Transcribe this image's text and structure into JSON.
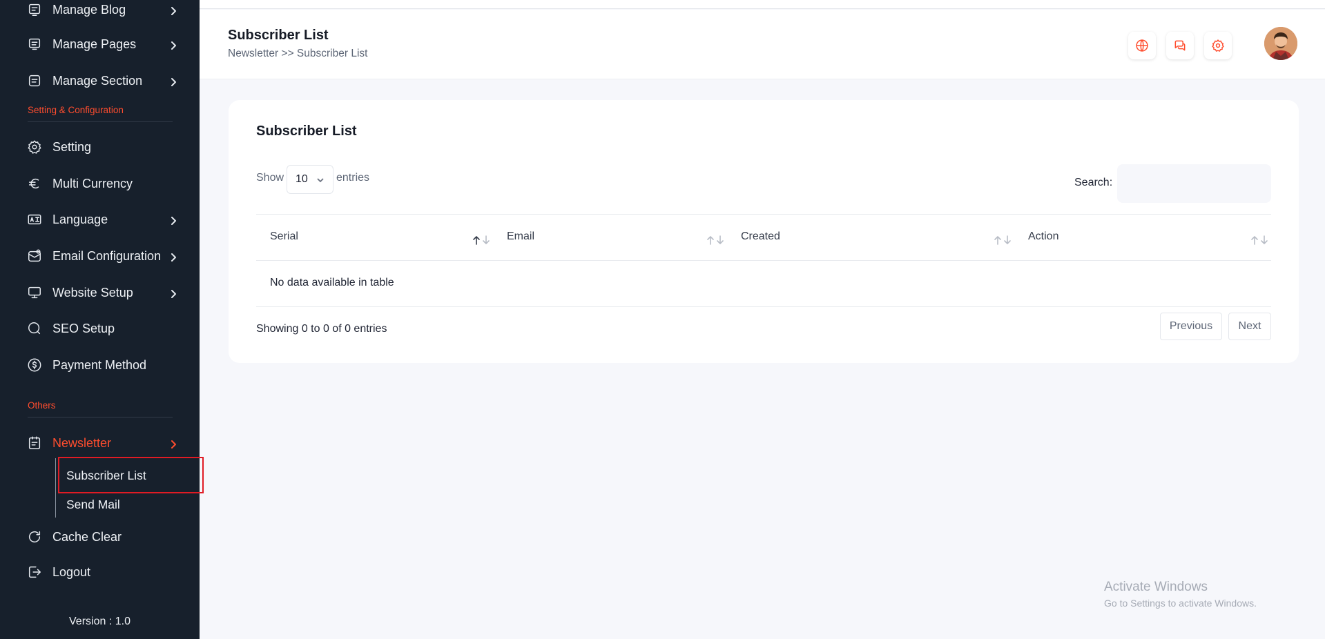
{
  "sidebar": {
    "items": [
      {
        "label": "Manage Blog",
        "icon": "blog-icon"
      },
      {
        "label": "Manage Pages",
        "icon": "pages-icon"
      },
      {
        "label": "Manage Section",
        "icon": "section-icon"
      },
      {
        "label": "Setting",
        "icon": "gear-icon"
      },
      {
        "label": "Multi Currency",
        "icon": "euro-icon"
      },
      {
        "label": "Language",
        "icon": "language-icon"
      },
      {
        "label": "Email Configuration",
        "icon": "email-icon"
      },
      {
        "label": "Website Setup",
        "icon": "monitor-icon"
      },
      {
        "label": "SEO Setup",
        "icon": "search-icon"
      },
      {
        "label": "Payment Method",
        "icon": "dollar-icon"
      },
      {
        "label": "Newsletter",
        "icon": "newsletter-icon"
      },
      {
        "label": "Cache Clear",
        "icon": "refresh-icon"
      },
      {
        "label": "Logout",
        "icon": "logout-icon"
      }
    ],
    "sections": {
      "settings": "Setting & Configuration",
      "others": "Others"
    },
    "newsletter_sub": {
      "subscriber_list": "Subscriber List",
      "send_mail": "Send Mail"
    },
    "version": "Version : 1.0"
  },
  "header": {
    "title": "Subscriber List",
    "breadcrumb": "Newsletter >> Subscriber List",
    "icons": [
      "globe-icon",
      "chat-icon",
      "gear-icon"
    ],
    "accent": "#ff4d2e"
  },
  "card": {
    "title": "Subscriber List",
    "show_label": "Show",
    "entries_label": "entries",
    "page_length": "10",
    "search_label": "Search:",
    "search_value": "",
    "columns": [
      "Serial",
      "Email",
      "Created",
      "Action"
    ],
    "empty_message": "No data available in table",
    "info": "Showing 0 to 0 of 0 entries",
    "prev_label": "Previous",
    "next_label": "Next"
  },
  "watermark": {
    "title": "Activate Windows",
    "subtitle": "Go to Settings to activate Windows."
  }
}
